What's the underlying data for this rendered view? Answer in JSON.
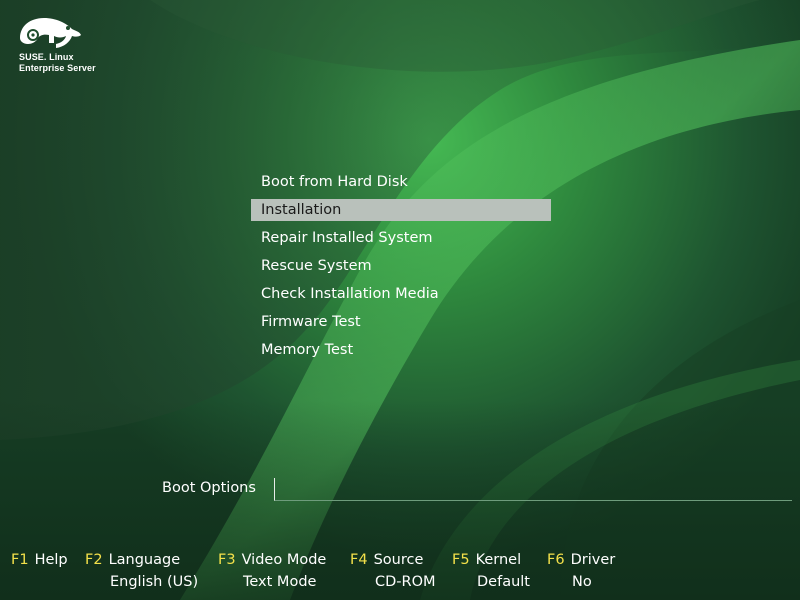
{
  "logo": {
    "line1": "SUSE. Linux",
    "line2": "Enterprise Server"
  },
  "boot_menu": {
    "items": [
      {
        "label": "Boot from Hard Disk",
        "selected": false
      },
      {
        "label": "Installation",
        "selected": true
      },
      {
        "label": "Repair Installed System",
        "selected": false
      },
      {
        "label": "Rescue System",
        "selected": false
      },
      {
        "label": "Check Installation Media",
        "selected": false
      },
      {
        "label": "Firmware Test",
        "selected": false
      },
      {
        "label": "Memory Test",
        "selected": false
      }
    ]
  },
  "boot_options": {
    "label": "Boot Options",
    "value": ""
  },
  "function_keys": [
    {
      "key": "F1",
      "label": "Help",
      "value": ""
    },
    {
      "key": "F2",
      "label": "Language",
      "value": "English (US)"
    },
    {
      "key": "F3",
      "label": "Video Mode",
      "value": "Text Mode"
    },
    {
      "key": "F4",
      "label": "Source",
      "value": "CD-ROM"
    },
    {
      "key": "F5",
      "label": "Kernel",
      "value": "Default"
    },
    {
      "key": "F6",
      "label": "Driver",
      "value": "No"
    }
  ],
  "colors": {
    "background": "#1d4a2c",
    "highlight": "#3fb04e",
    "selection": "#b9c1bb",
    "fkey": "#f3e04a",
    "text": "#ffffff"
  }
}
